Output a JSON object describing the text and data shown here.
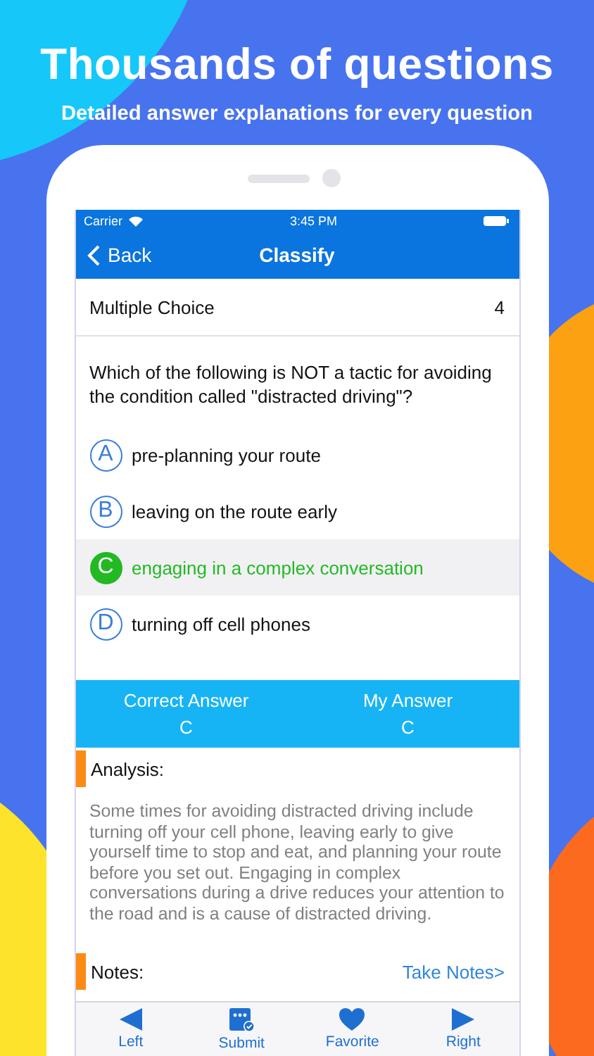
{
  "header": {
    "title": "Thousands of questions",
    "subtitle": "Detailed answer explanations for every question"
  },
  "status_bar": {
    "carrier": "Carrier",
    "time": "3:45 PM"
  },
  "nav": {
    "back": "Back",
    "title": "Classify"
  },
  "question": {
    "type": "Multiple Choice",
    "number": "4",
    "text": "Which of the following is NOT a tactic for avoiding the condition called \"distracted driving\"?",
    "options": [
      {
        "letter": "A",
        "text": "pre-planning your route",
        "selected": false
      },
      {
        "letter": "B",
        "text": "leaving on the route early",
        "selected": false
      },
      {
        "letter": "C",
        "text": "engaging in a complex conversation",
        "selected": true
      },
      {
        "letter": "D",
        "text": "turning off cell phones",
        "selected": false
      }
    ]
  },
  "answers": [
    {
      "label": "Correct Answer",
      "value": "C"
    },
    {
      "label": "My Answer",
      "value": "C"
    }
  ],
  "analysis": {
    "label": "Analysis:",
    "text": "Some times for avoiding distracted driving include turning off your cell phone, leaving early to give yourself time to stop and eat, and planning your route before you set out. Engaging in complex conversations during a drive reduces your attention to the road and is a cause of distracted driving."
  },
  "notes": {
    "label": "Notes:",
    "action": "Take Notes>"
  },
  "tab_bar": [
    {
      "kind": "left",
      "label": "Left"
    },
    {
      "kind": "submit",
      "label": "Submit"
    },
    {
      "kind": "favorite",
      "label": "Favorite"
    },
    {
      "kind": "right",
      "label": "Right"
    }
  ]
}
